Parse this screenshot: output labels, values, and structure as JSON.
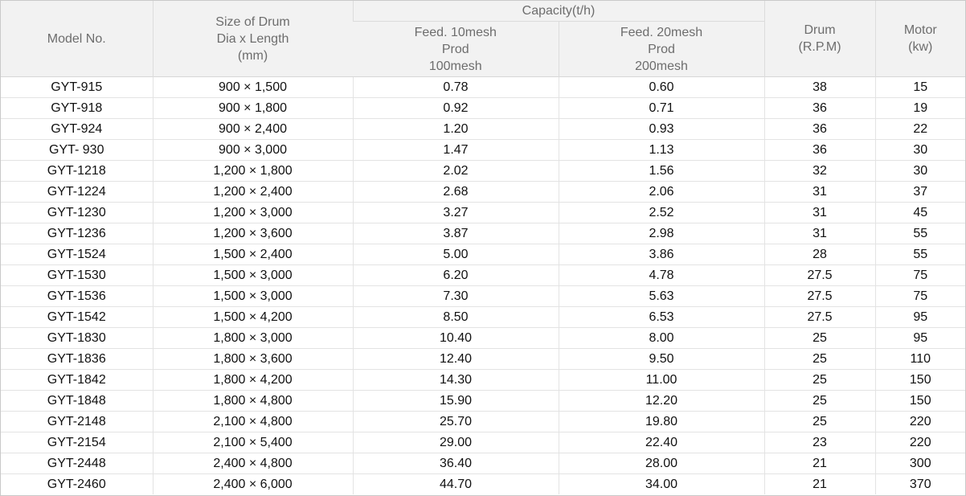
{
  "header": {
    "model": "Model No.",
    "size": [
      "Size of Drum",
      "Dia x Length",
      "(mm)"
    ],
    "capacity": "Capacity(t/h)",
    "feed10": [
      "Feed. 10mesh",
      "Prod",
      "100mesh"
    ],
    "feed20": [
      "Feed. 20mesh",
      "Prod",
      "200mesh"
    ],
    "drum": [
      "Drum",
      "(R.P.M)"
    ],
    "motor": [
      "Motor",
      "(kw)"
    ]
  },
  "rows": [
    [
      "GYT-915",
      "900 × 1,500",
      "0.78",
      "0.60",
      "38",
      "15"
    ],
    [
      "GYT-918",
      "900 × 1,800",
      "0.92",
      "0.71",
      "36",
      "19"
    ],
    [
      "GYT-924",
      "900 × 2,400",
      "1.20",
      "0.93",
      "36",
      "22"
    ],
    [
      "GYT- 930",
      "900 × 3,000",
      "1.47",
      "1.13",
      "36",
      "30"
    ],
    [
      "GYT-1218",
      "1,200 × 1,800",
      "2.02",
      "1.56",
      "32",
      "30"
    ],
    [
      "GYT-1224",
      "1,200 × 2,400",
      "2.68",
      "2.06",
      "31",
      "37"
    ],
    [
      "GYT-1230",
      "1,200 × 3,000",
      "3.27",
      "2.52",
      "31",
      "45"
    ],
    [
      "GYT-1236",
      "1,200 × 3,600",
      "3.87",
      "2.98",
      "31",
      "55"
    ],
    [
      "GYT-1524",
      "1,500 × 2,400",
      "5.00",
      "3.86",
      "28",
      "55"
    ],
    [
      "GYT-1530",
      "1,500 × 3,000",
      "6.20",
      "4.78",
      "27.5",
      "75"
    ],
    [
      "GYT-1536",
      "1,500 × 3,000",
      "7.30",
      "5.63",
      "27.5",
      "75"
    ],
    [
      "GYT-1542",
      "1,500 × 4,200",
      "8.50",
      "6.53",
      "27.5",
      "95"
    ],
    [
      "GYT-1830",
      "1,800 × 3,000",
      "10.40",
      "8.00",
      "25",
      "95"
    ],
    [
      "GYT-1836",
      "1,800 × 3,600",
      "12.40",
      "9.50",
      "25",
      "110"
    ],
    [
      "GYT-1842",
      "1,800 × 4,200",
      "14.30",
      "11.00",
      "25",
      "150"
    ],
    [
      "GYT-1848",
      "1,800 × 4,800",
      "15.90",
      "12.20",
      "25",
      "150"
    ],
    [
      "GYT-2148",
      "2,100 × 4,800",
      "25.70",
      "19.80",
      "25",
      "220"
    ],
    [
      "GYT-2154",
      "2,100 × 5,400",
      "29.00",
      "22.40",
      "23",
      "220"
    ],
    [
      "GYT-2448",
      "2,400 × 4,800",
      "36.40",
      "28.00",
      "21",
      "300"
    ],
    [
      "GYT-2460",
      "2,400 × 6,000",
      "44.70",
      "34.00",
      "21",
      "370"
    ]
  ]
}
